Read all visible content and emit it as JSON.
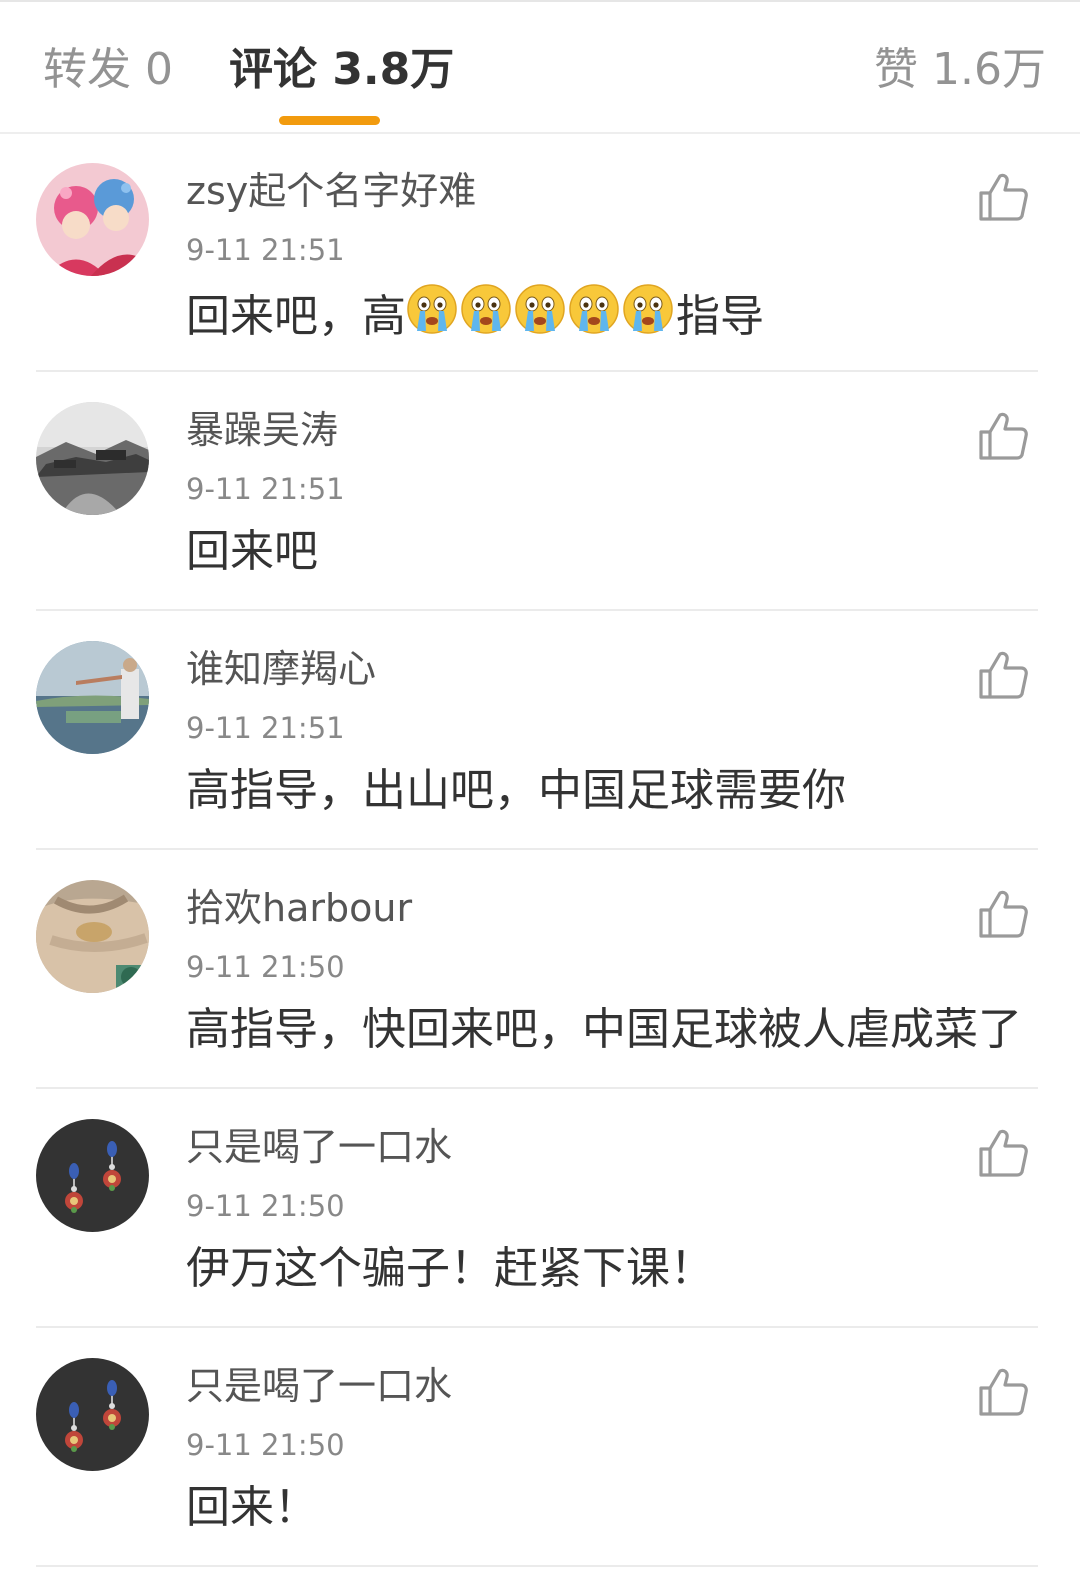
{
  "tabs": {
    "repost": "转发 0",
    "comments": "评论 3.8万",
    "likes": "赞 1.6万",
    "active_color": "#f29b0e"
  },
  "comments": [
    {
      "user": "zsy起个名字好难",
      "time": "9-11 21:51",
      "text_before": "回来吧，高",
      "emoji": "crying-face",
      "emoji_count": 5,
      "text_after": "指导"
    },
    {
      "user": "暴躁吴涛",
      "time": "9-11 21:51",
      "text": "回来吧"
    },
    {
      "user": "谁知摩羯心",
      "time": "9-11 21:51",
      "text": "高指导，出山吧，中国足球需要你"
    },
    {
      "user": "拾欢harbour",
      "time": "9-11 21:50",
      "text": "高指导，快回来吧，中国足球被人虐成菜了"
    },
    {
      "user": "只是喝了一口水",
      "time": "9-11 21:50",
      "text": "伊万这个骗子！赶紧下课！"
    },
    {
      "user": "只是喝了一口水",
      "time": "9-11 21:50",
      "text": "回来！"
    }
  ],
  "icons": {
    "like": "thumbs-up-icon"
  }
}
